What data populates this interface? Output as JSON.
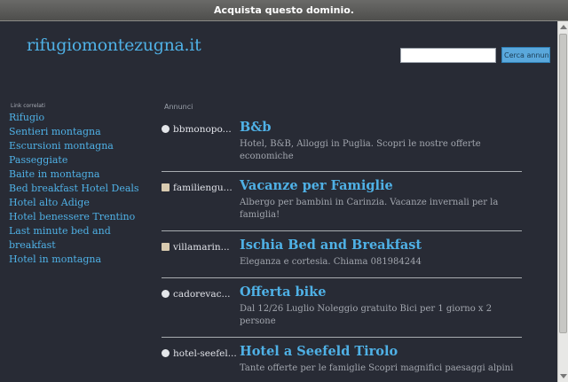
{
  "topbar": {
    "text": "Acquista questo dominio."
  },
  "header": {
    "title": "rifugiomontezugna.it"
  },
  "search": {
    "placeholder": "",
    "button_label": "Cerca annunci"
  },
  "related": {
    "heading": "Link correlati",
    "links": [
      "Rifugio",
      "Sentieri montagna",
      "Escursioni montagna",
      "Passeggiate",
      "Baite in montagna",
      "Bed breakfast Hotel Deals",
      "Hotel alto Adige",
      "Hotel benessere Trentino",
      "Last minute bed and breakfast",
      "Hotel in montagna"
    ]
  },
  "ads": {
    "heading": "Annunci",
    "items": [
      {
        "domain": "bbmonopo...",
        "title": "B&b",
        "desc": "Hotel, B&B, Alloggi in Puglia. Scopri le nostre offerte economiche",
        "icon": "globe-icon"
      },
      {
        "domain": "familiengu...",
        "title": "Vacanze per Famiglie",
        "desc": "Albergo per bambini in Carinzia. Vacanze invernali per la famiglia!",
        "icon": "favicon-icon"
      },
      {
        "domain": "villamarin...",
        "title": "Ischia Bed and Breakfast",
        "desc": "Eleganza e cortesia. Chiama 081984244",
        "icon": "favicon-icon"
      },
      {
        "domain": "cadorevac...",
        "title": "Offerta bike",
        "desc": "Dal 12/26 Luglio Noleggio gratuito Bici per 1 giorno x 2 persone",
        "icon": "globe-icon"
      },
      {
        "domain": "hotel-seefel...",
        "title": "Hotel a Seefeld Tirolo",
        "desc": "Tante offerte per le famiglie Scopri magnifici paesaggi alpini",
        "icon": "globe-icon"
      }
    ]
  },
  "colors": {
    "background": "#282b35",
    "link": "#4fb1e6",
    "button": "#5aa8dc"
  }
}
